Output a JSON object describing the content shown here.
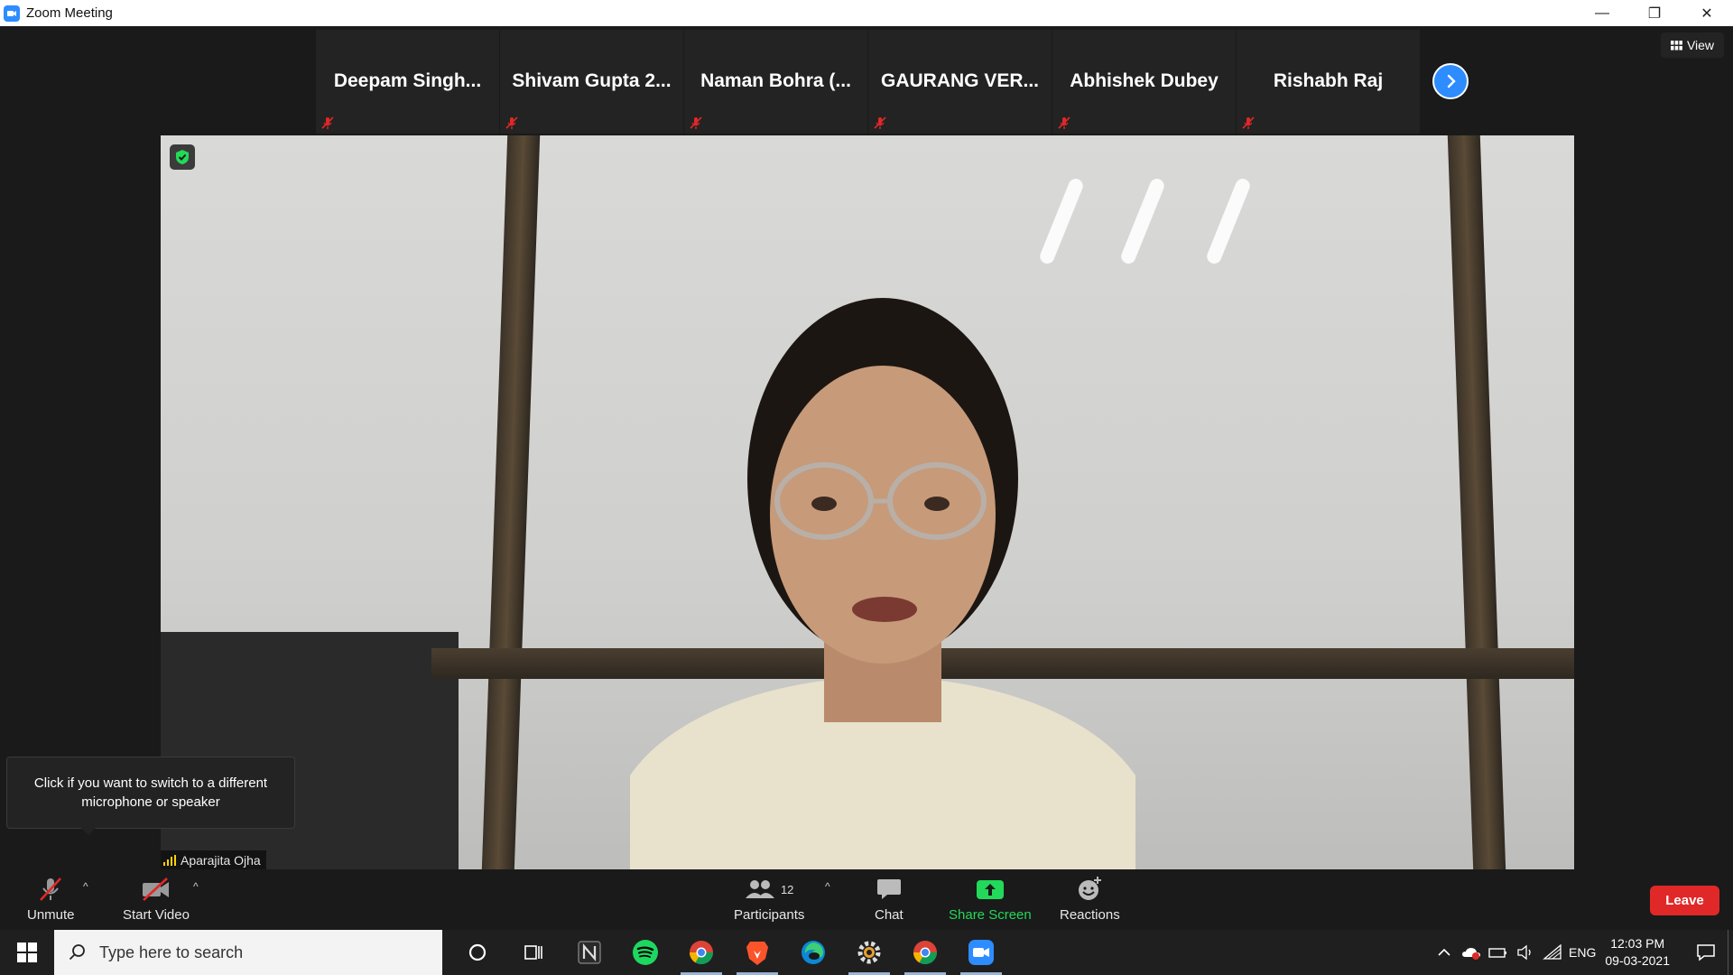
{
  "window": {
    "title": "Zoom Meeting",
    "controls": {
      "minimize": "—",
      "restore": "❐",
      "close": "✕"
    }
  },
  "participants_strip": [
    {
      "name": "Deepam Singh..."
    },
    {
      "name": "Shivam Gupta 2..."
    },
    {
      "name": "Naman Bohra (..."
    },
    {
      "name": "GAURANG VER..."
    },
    {
      "name": "Abhishek Dubey"
    },
    {
      "name": "Rishabh Raj"
    }
  ],
  "view_button": {
    "label": "View"
  },
  "main_video": {
    "speaker_name": "Aparajita Ojha"
  },
  "tooltip": {
    "text": "Click if you want to switch to a different microphone or speaker"
  },
  "toolbar": {
    "unmute": "Unmute",
    "start_video": "Start Video",
    "participants": "Participants",
    "participants_count": "12",
    "chat": "Chat",
    "share_screen": "Share Screen",
    "reactions": "Reactions",
    "leave": "Leave"
  },
  "taskbar": {
    "search_placeholder": "Type here to search",
    "language": "ENG",
    "time": "12:03 PM",
    "date": "09-03-2021"
  },
  "colors": {
    "zoom_blue": "#2d8cff",
    "share_green": "#23d959",
    "leave_red": "#e02828",
    "mute_red": "#e02828"
  }
}
